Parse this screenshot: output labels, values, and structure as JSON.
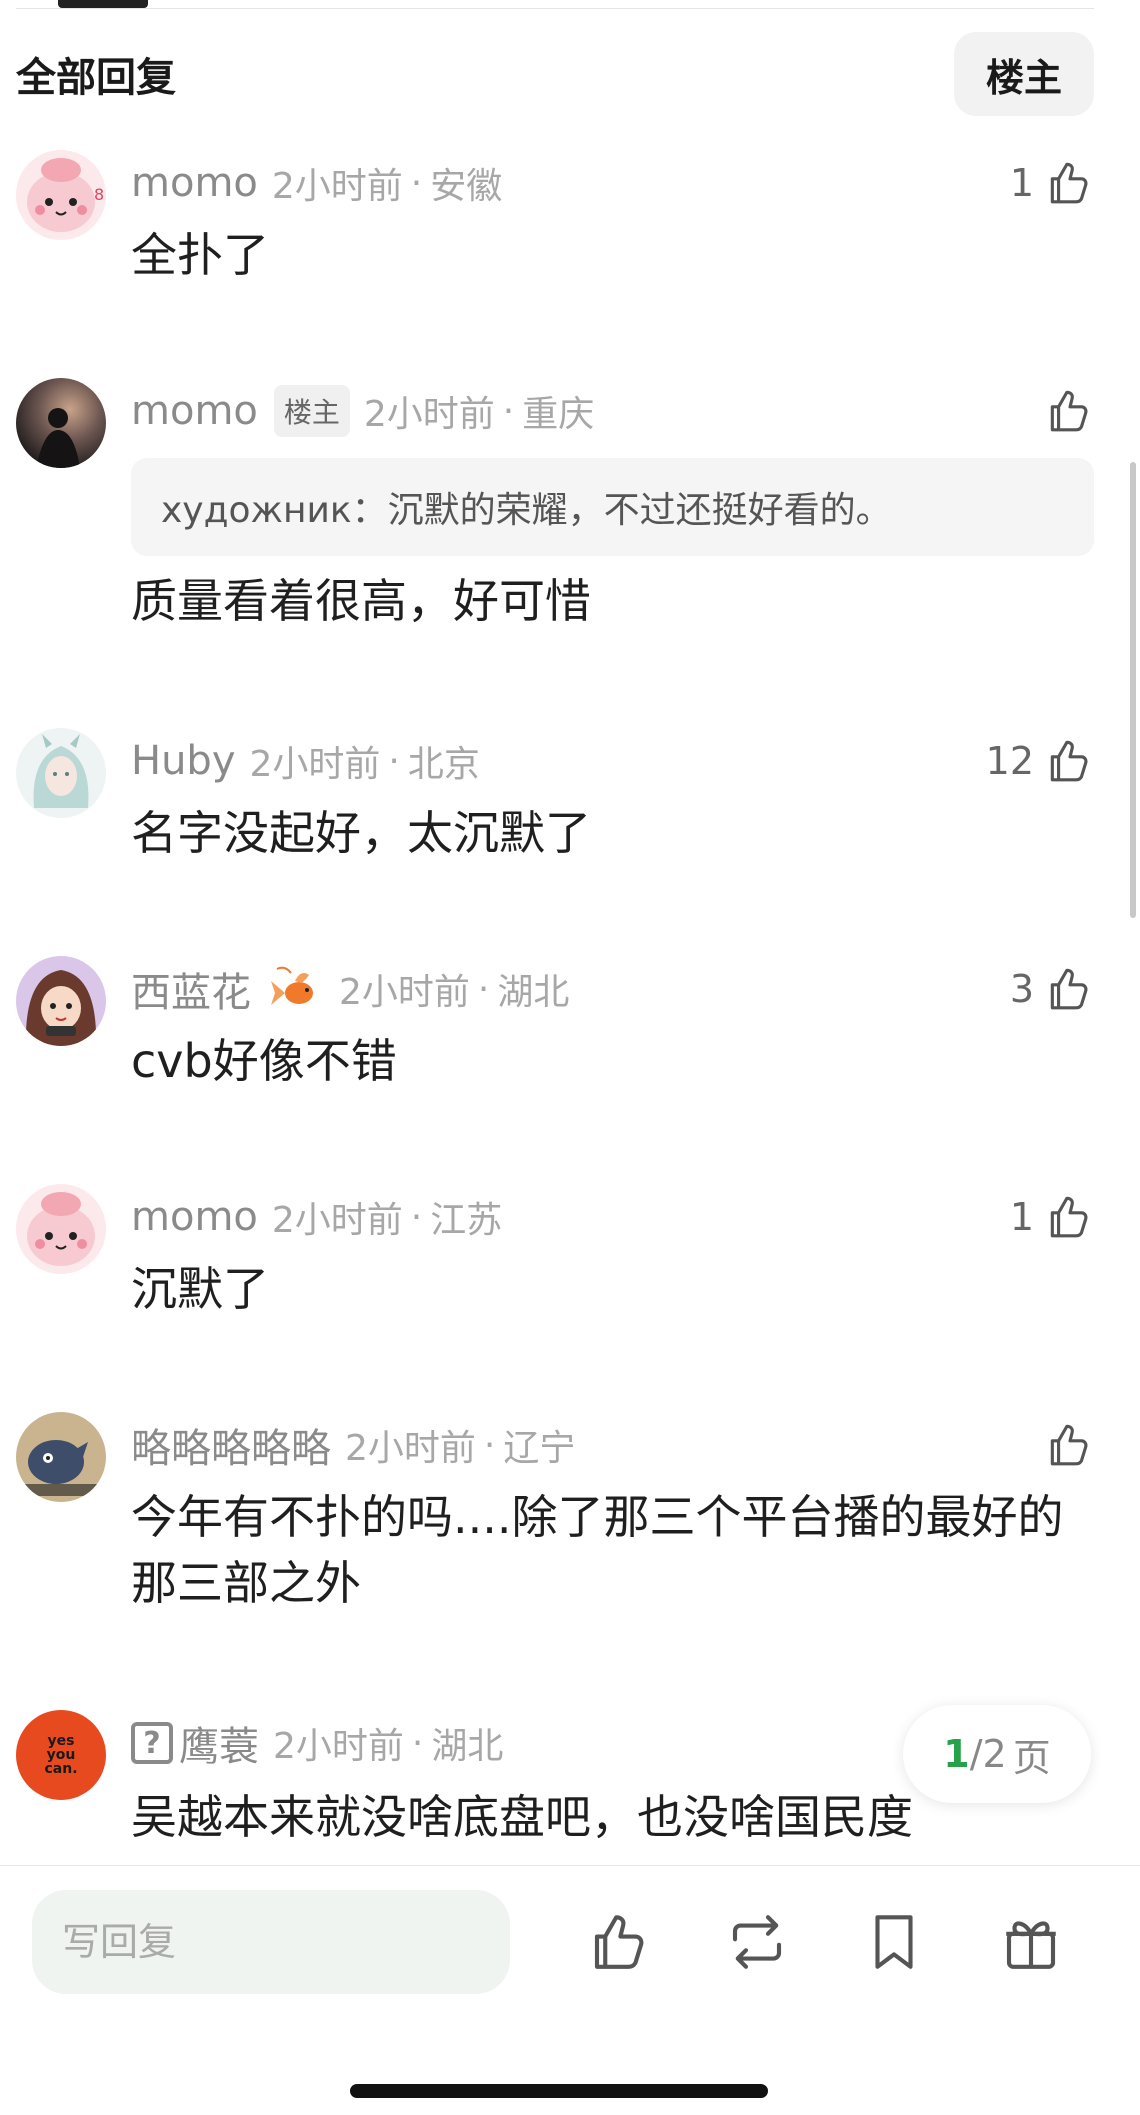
{
  "header": {
    "title": "全部回复",
    "op_filter_label": "楼主"
  },
  "comments": [
    {
      "username": "momo",
      "badge": "",
      "time": "2小时前",
      "location": "安徽",
      "likes": "1",
      "text": "全扑了",
      "quote": "",
      "avatar": "pink-bunny-avatar"
    },
    {
      "username": "momo",
      "badge": "楼主",
      "time": "2小时前",
      "location": "重庆",
      "likes": "",
      "text": "质量看着很高，好可惜",
      "quote": "художник：沉默的荣耀，不过还挺好看的。",
      "avatar": "sunset-silhouette-avatar"
    },
    {
      "username": "Huby",
      "badge": "",
      "time": "2小时前",
      "location": "北京",
      "likes": "12",
      "text": "名字没起好，太沉默了",
      "quote": "",
      "avatar": "anime-girl-avatar"
    },
    {
      "username": "西蓝花",
      "badge": "",
      "time": "2小时前",
      "location": "湖北",
      "likes": "3",
      "text": "cvb好像不错",
      "quote": "",
      "avatar": "cartoon-girl-avatar"
    },
    {
      "username": "momo",
      "badge": "",
      "time": "2小时前",
      "location": "江苏",
      "likes": "1",
      "text": "沉默了",
      "quote": "",
      "avatar": "pink-bunny-avatar"
    },
    {
      "username": "略略略略略",
      "badge": "",
      "time": "2小时前",
      "location": "辽宁",
      "likes": "",
      "text": "今年有不扑的吗....除了那三个平台播的最好的那三部之外",
      "quote": "",
      "avatar": "cartoon-cat-avatar"
    },
    {
      "username": "鹰蓑",
      "badge": "",
      "time": "2小时前",
      "location": "湖北",
      "likes": "",
      "text": "吴越本来就没啥底盘吧，也没啥国民度",
      "quote": "",
      "avatar": "yes-you-can-avatar",
      "avatar_text": [
        "yes",
        "you",
        "can."
      ]
    }
  ],
  "pagination": {
    "current": "1",
    "total": "/2",
    "suffix": "页"
  },
  "bottom_bar": {
    "reply_placeholder": "写回复"
  },
  "icons": {
    "like": "thumbs-up-icon",
    "repost": "repost-icon",
    "bookmark": "bookmark-icon",
    "gift": "gift-icon"
  },
  "colors": {
    "accent_green": "#27a14a",
    "muted_text": "#8a8a8a",
    "yes_you_can_bg": "#e84a1f"
  }
}
